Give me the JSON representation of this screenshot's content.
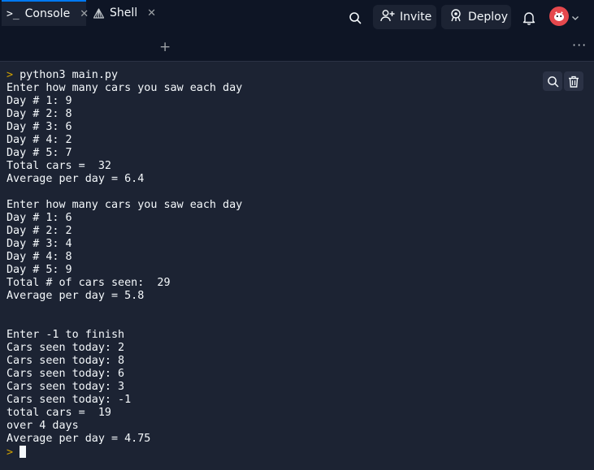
{
  "header": {
    "invite_label": "Invite",
    "deploy_label": "Deploy",
    "icons": [
      "search-icon",
      "add-user-icon",
      "deploy-icon",
      "bell-icon",
      "avatar",
      "chevron-down-icon"
    ]
  },
  "tabs": [
    {
      "label": "Console",
      "icon": "terminal-icon",
      "active": true
    },
    {
      "label": "Shell",
      "icon": "shell-icon",
      "active": false
    }
  ],
  "console": {
    "command": "python3 main.py",
    "prompt_symbol": ">",
    "lines": [
      "Enter how many cars you saw each day",
      "Day # 1: 9",
      "Day # 2: 8",
      "Day # 3: 6",
      "Day # 4: 2",
      "Day # 5: 7",
      "Total cars =  32",
      "Average per day = 6.4",
      "",
      "Enter how many cars you saw each day",
      "Day # 1: 6",
      "Day # 2: 2",
      "Day # 3: 4",
      "Day # 4: 8",
      "Day # 5: 9",
      "Total # of cars seen:  29",
      "Average per day = 5.8",
      "",
      "",
      "Enter -1 to finish",
      "Cars seen today: 2",
      "Cars seen today: 8",
      "Cars seen today: 6",
      "Cars seen today: 3",
      "Cars seen today: -1",
      "total cars =  19",
      "over 4 days",
      "Average per day = 4.75"
    ]
  },
  "colors": {
    "background": "#1c2333",
    "topbar": "#0e1525",
    "accent": "#0079f2",
    "prompt": "#d0a100",
    "avatar": "#e5484d"
  }
}
